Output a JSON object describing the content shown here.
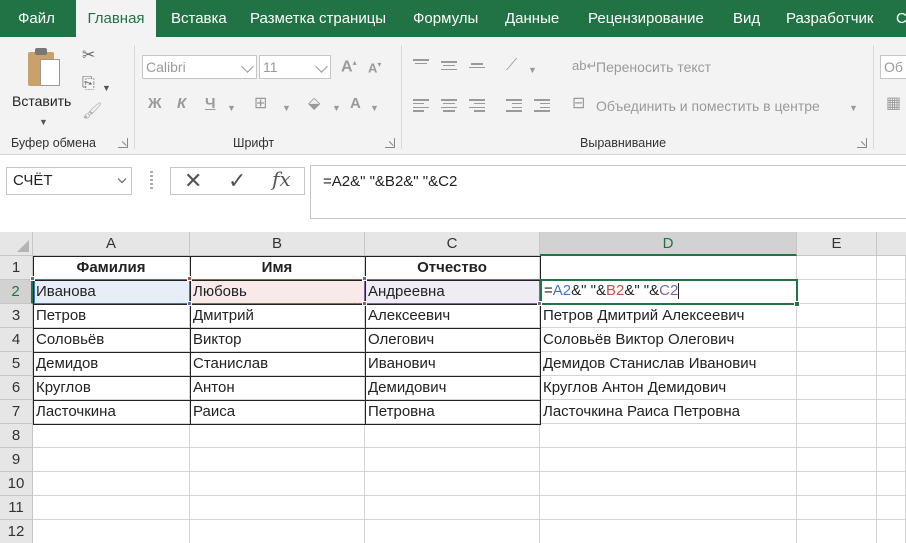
{
  "ribbon_tabs": [
    "Файл",
    "Главная",
    "Вставка",
    "Разметка страницы",
    "Формулы",
    "Данные",
    "Рецензирование",
    "Вид",
    "Разработчик",
    "С"
  ],
  "active_tab": "Главная",
  "clipboard": {
    "paste_label": "Вставить",
    "group_label": "Буфер обмена"
  },
  "font": {
    "name": "Calibri",
    "size": "11",
    "group_label": "Шрифт",
    "bold": "Ж",
    "italic": "К",
    "underline": "Ч",
    "grow": "A",
    "shrink": "A",
    "color_a": "A"
  },
  "alignment": {
    "wrap_text": "Переносить текст",
    "merge_center": "Объединить и поместить в центре",
    "group_label": "Выравнивание"
  },
  "number_format_partial": "Об",
  "formula_bar": {
    "name_box": "СЧЁТ",
    "formula": "=A2&\" \"&B2&\" \"&C2",
    "fx": "fx"
  },
  "columns": [
    "A",
    "B",
    "C",
    "D",
    "E"
  ],
  "rows": [
    "1",
    "2",
    "3",
    "4",
    "5",
    "6",
    "7",
    "8",
    "9",
    "10",
    "11",
    "12"
  ],
  "headers": [
    "Фамилия",
    "Имя",
    "Отчество"
  ],
  "table": [
    [
      "Иванова",
      "Любовь",
      "Андреевна",
      ""
    ],
    [
      "Петров",
      "Дмитрий",
      "Алексеевич",
      "Петров Дмитрий Алексеевич"
    ],
    [
      "Соловьёв",
      "Виктор",
      "Олегович",
      "Соловьёв Виктор Олегович"
    ],
    [
      "Демидов",
      "Станислав",
      "Иванович",
      "Демидов Станислав Иванович"
    ],
    [
      "Круглов",
      "Антон",
      "Демидович",
      "Круглов Антон Демидович"
    ],
    [
      "Ласточкина",
      "Раиса",
      "Петровна",
      "Ласточкина Раиса Петровна"
    ]
  ],
  "active_cell_edit": {
    "parts": [
      "=",
      "A2",
      "&\" \"&",
      "B2",
      "&\" \"&",
      "C2"
    ],
    "colors": {
      "A2": "#4472c4",
      "B2": "#c0504d",
      "C2": "#8064a2"
    }
  },
  "accent_color": "#217346"
}
